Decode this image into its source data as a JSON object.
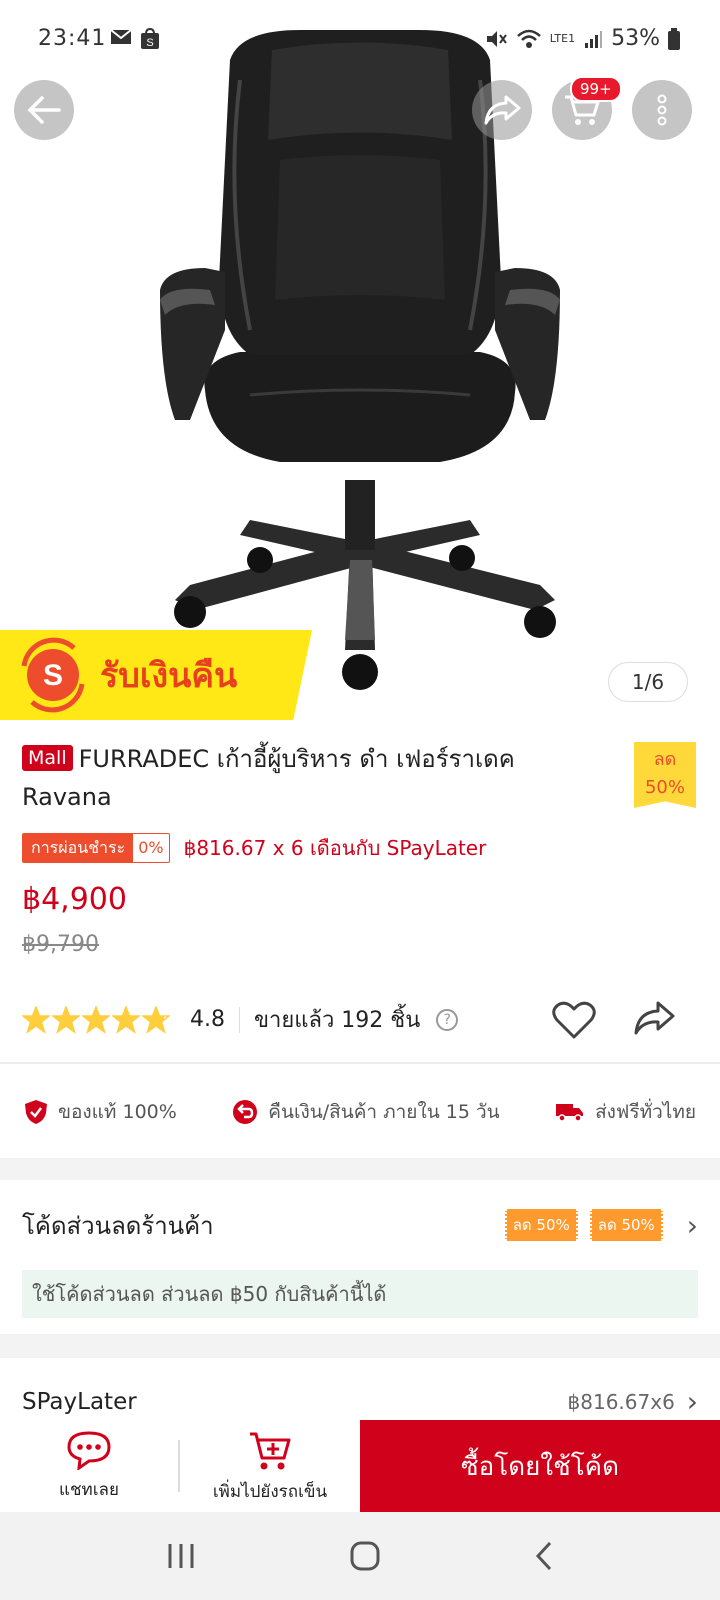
{
  "status_bar": {
    "time": "23:41",
    "battery": "53%",
    "network": "LTE1"
  },
  "header": {
    "cart_badge": "99+"
  },
  "gallery": {
    "banner_text": "รับเงินคืน",
    "banner_logo": "S",
    "counter": "1/6"
  },
  "product": {
    "mall_badge": "Mall",
    "title": "FURRADEC เก้าอี้ผู้บริหาร ดำ เฟอร์ราเดค Ravana",
    "discount_label": "ลด",
    "discount_value": "50%",
    "installment_label": "การผ่อนชำระ",
    "installment_rate": "0%",
    "installment_text": "฿816.67 x 6 เดือนกับ SPayLater",
    "price": "฿4,900",
    "old_price": "฿9,790",
    "rating": "4.8",
    "rating_fraction": 0.96,
    "sold": "ขายแล้ว 192 ชิ้น",
    "help_symbol": "?"
  },
  "guarantees": [
    {
      "label": "ของแท้ 100%",
      "icon": "shield-check-icon"
    },
    {
      "label": "คืนเงิน/สินค้า ภายใน 15 วัน",
      "icon": "return-icon"
    },
    {
      "label": "ส่งฟรีทั่วไทย",
      "icon": "truck-icon"
    }
  ],
  "voucher": {
    "title": "โค้ดส่วนลดร้านค้า",
    "tags": [
      "ลด 50%",
      "ลด 50%"
    ],
    "note": "ใช้โค้ดส่วนลด ส่วนลด ฿50 กับสินค้านี้ได้"
  },
  "spaylater": {
    "label": "SPayLater",
    "value": "฿816.67x6"
  },
  "action_bar": {
    "chat_label": "แชทเลย",
    "cart_label": "เพิ่มไปยังรถเข็น",
    "buy_label": "ซื้อโดยใช้โค้ด"
  },
  "colors": {
    "brand_red": "#d0011b",
    "accent_orange": "#ee4d2d",
    "cashback_yellow": "#ffe815",
    "star_yellow": "#ffce3d"
  }
}
